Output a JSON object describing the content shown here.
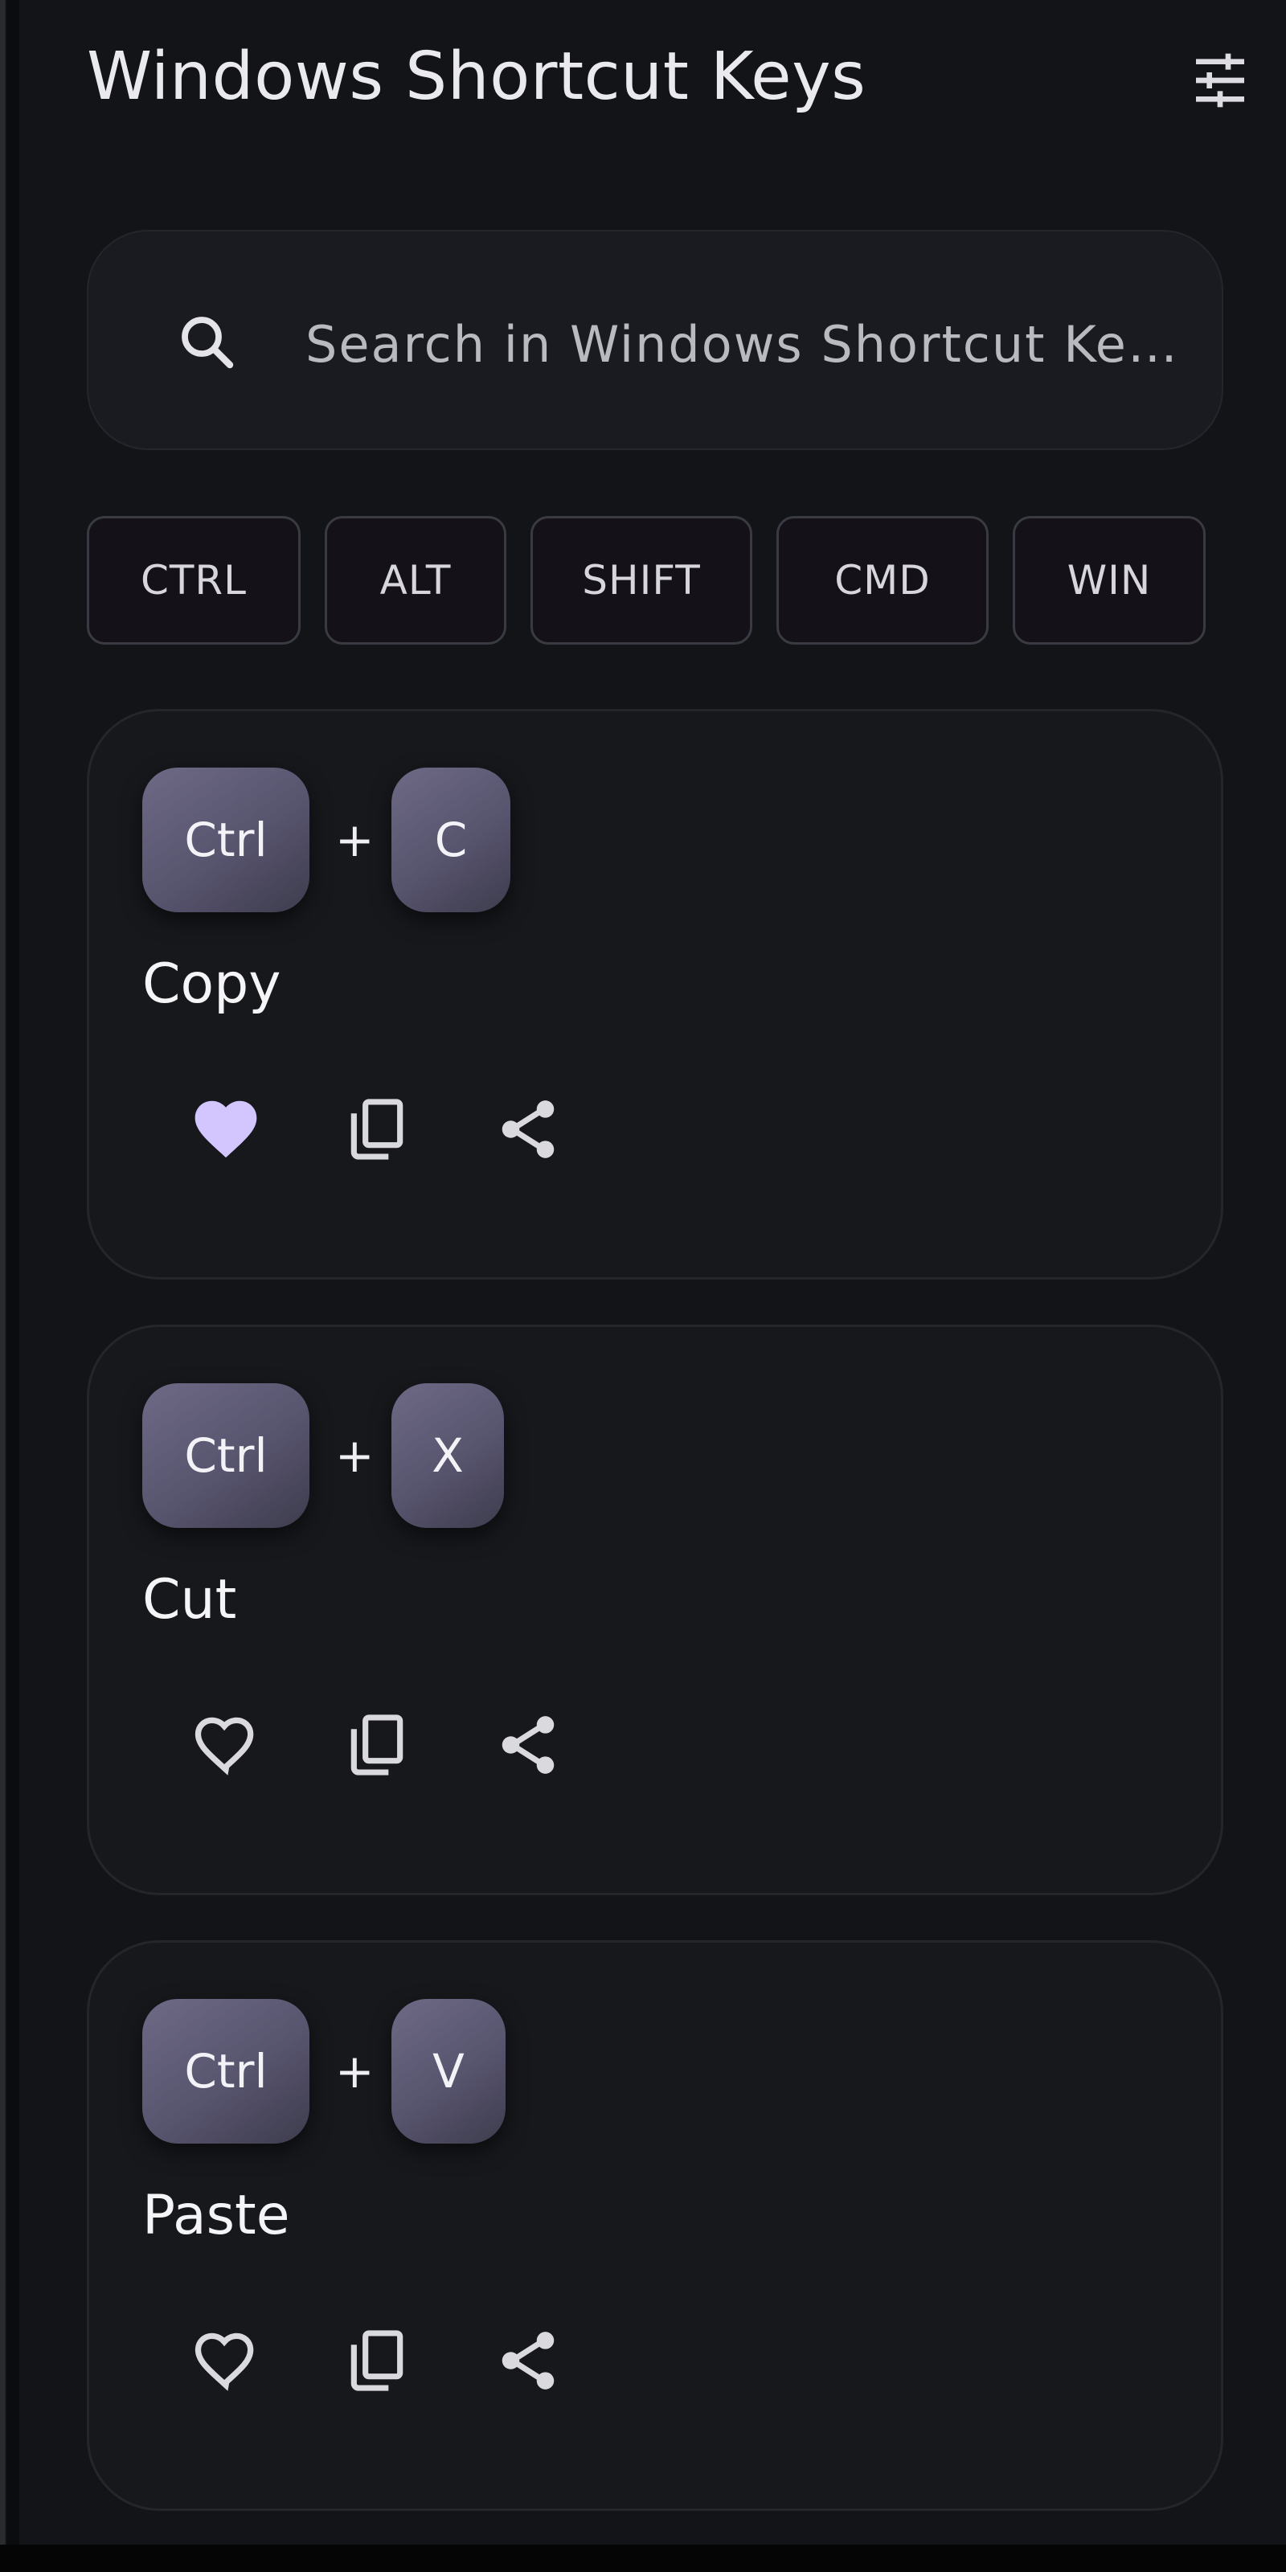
{
  "header": {
    "title": "Windows Shortcut Keys",
    "filter_icon": "tune-sliders-icon"
  },
  "search": {
    "placeholder": "Search in Windows Shortcut Ke…",
    "value": "",
    "icon": "search-icon"
  },
  "modifiers": [
    "CTRL",
    "ALT",
    "SHIFT",
    "CMD",
    "WIN"
  ],
  "shortcuts": [
    {
      "keys": [
        "Ctrl",
        "C"
      ],
      "action": "Copy",
      "favorite": true
    },
    {
      "keys": [
        "Ctrl",
        "X"
      ],
      "action": "Cut",
      "favorite": false
    },
    {
      "keys": [
        "Ctrl",
        "V"
      ],
      "action": "Paste",
      "favorite": false
    }
  ],
  "separator": "+",
  "colors": {
    "background": "#121418",
    "card": "#17181c",
    "key_cap": "#5a5670",
    "favorite_active": "#d3c6ff",
    "icon": "#d9d9de"
  }
}
